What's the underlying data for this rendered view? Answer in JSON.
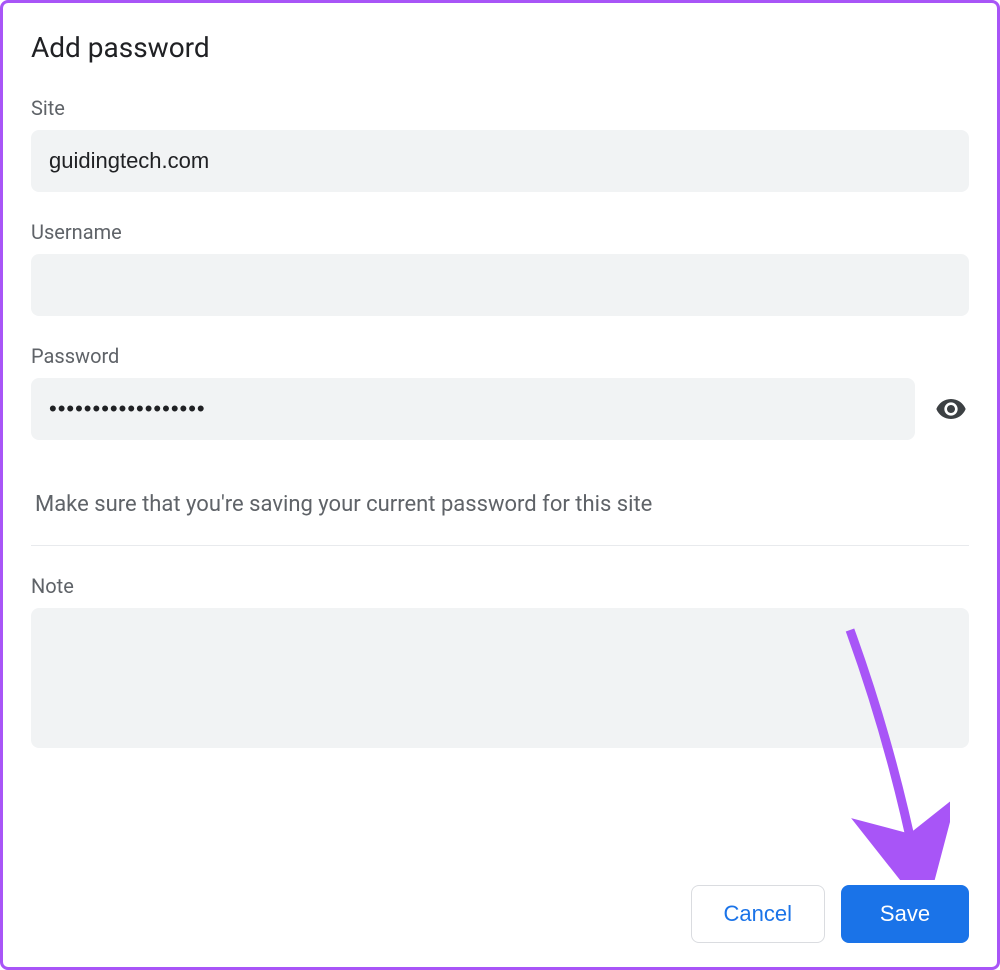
{
  "dialog": {
    "title": "Add password",
    "site_label": "Site",
    "site_value": "guidingtech.com",
    "username_label": "Username",
    "username_value": "",
    "password_label": "Password",
    "password_value": "••••••••••••••••••",
    "help_text": "Make sure that you're saving your current password for this site",
    "note_label": "Note",
    "note_value": "",
    "cancel_label": "Cancel",
    "save_label": "Save"
  }
}
